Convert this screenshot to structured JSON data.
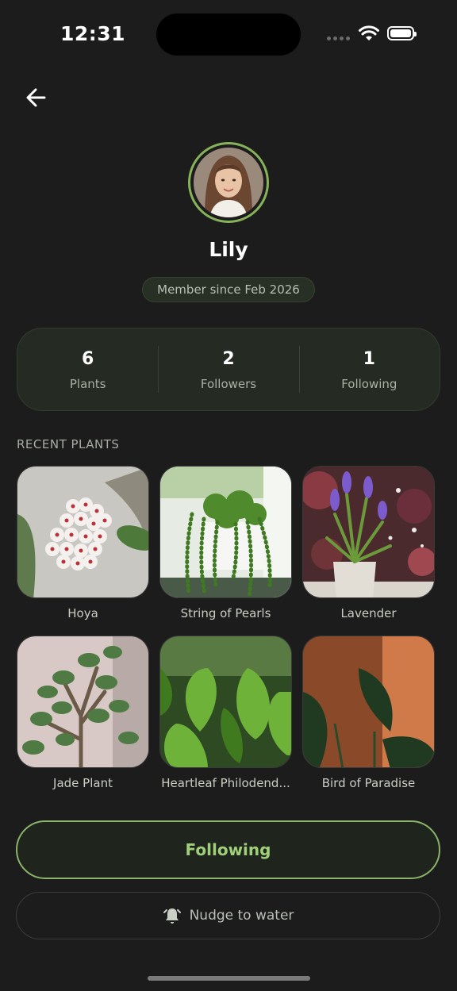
{
  "status_bar": {
    "time": "12:31"
  },
  "profile": {
    "name": "Lily",
    "member_since": "Member since Feb 2026"
  },
  "stats": [
    {
      "value": "6",
      "label": "Plants"
    },
    {
      "value": "2",
      "label": "Followers"
    },
    {
      "value": "1",
      "label": "Following"
    }
  ],
  "recent_plants": {
    "title": "RECENT PLANTS",
    "items": [
      {
        "name": "Hoya"
      },
      {
        "name": "String of Pearls"
      },
      {
        "name": "Lavender"
      },
      {
        "name": "Jade Plant"
      },
      {
        "name": "Heartleaf Philodend..."
      },
      {
        "name": "Bird of Paradise"
      }
    ]
  },
  "actions": {
    "following_label": "Following",
    "nudge_label": "Nudge to water"
  },
  "colors": {
    "background": "#1c1c1c",
    "accent_green": "#8ab46a",
    "card": "#252a22"
  },
  "icons": [
    "back-arrow-icon",
    "wifi-icon",
    "battery-icon",
    "bell-icon"
  ]
}
